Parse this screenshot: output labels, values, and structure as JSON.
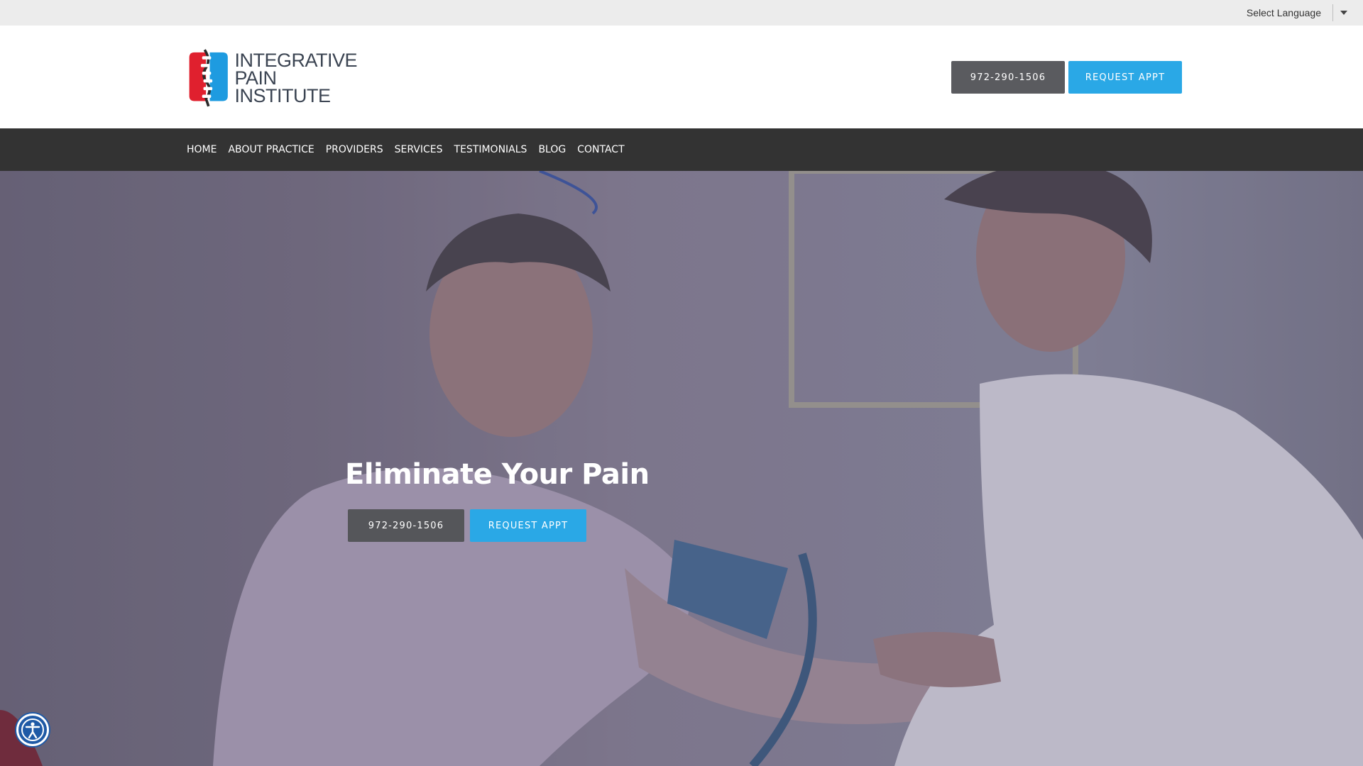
{
  "topbar": {
    "language_label": "Select Language"
  },
  "header": {
    "logo_lines": [
      "INTEGRATIVE",
      "PAIN",
      "INSTITUTE"
    ],
    "phone_label": "972-290-1506",
    "request_label": "REQUEST APPT"
  },
  "nav": {
    "items": [
      "HOME",
      "ABOUT PRACTICE",
      "PROVIDERS",
      "SERVICES",
      "TESTIMONIALS",
      "BLOG",
      "CONTACT"
    ]
  },
  "hero": {
    "title": "Eliminate Your Pain",
    "phone_label": "972-290-1506",
    "request_label": "REQUEST APPT"
  },
  "colors": {
    "accent": "#2aa8e6",
    "button_dark": "#5a5b5f",
    "nav_bg": "#333333",
    "logo_red": "#e0202e",
    "logo_blue": "#1e9be0"
  },
  "icons": {
    "language_dropdown": "chevron-down-icon",
    "accessibility": "accessibility-icon"
  }
}
